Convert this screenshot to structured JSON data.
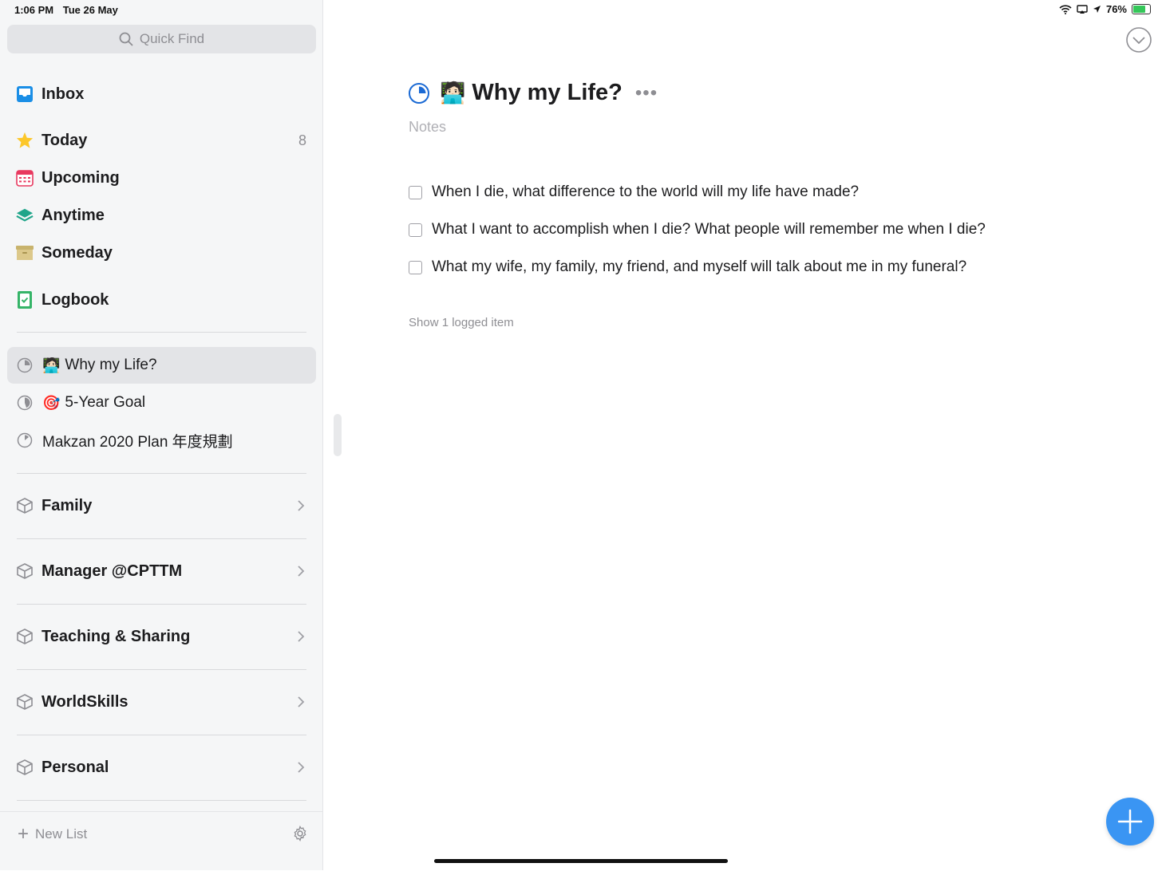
{
  "status_bar": {
    "time": "1:06 PM",
    "date": "Tue 26 May",
    "battery_percent": "76%"
  },
  "search": {
    "placeholder": "Quick Find"
  },
  "nav": {
    "inbox": "Inbox",
    "today": "Today",
    "today_count": "8",
    "upcoming": "Upcoming",
    "anytime": "Anytime",
    "someday": "Someday",
    "logbook": "Logbook"
  },
  "projects": [
    {
      "emoji": "🧑🏻‍💻",
      "label": "Why my Life?"
    },
    {
      "emoji": "🎯",
      "label": "5-Year Goal"
    },
    {
      "emoji": "",
      "label": "Makzan 2020 Plan 年度規劃"
    }
  ],
  "areas": [
    {
      "label": "Family"
    },
    {
      "label": "Manager @CPTTM"
    },
    {
      "label": "Teaching & Sharing"
    },
    {
      "label": "WorldSkills"
    },
    {
      "label": "Personal"
    }
  ],
  "footer": {
    "new_list": "New List"
  },
  "main": {
    "title_emoji": "🧑🏻‍💻",
    "title": "Why my Life?",
    "more": "•••",
    "notes_placeholder": "Notes",
    "todos": [
      "When I die, what difference to the world will my life have made?",
      "What I want to accomplish when I die? What people will remember me when I die?",
      "What my wife, my family, my friend, and myself will talk about me in my funeral?"
    ],
    "logged_link": "Show 1 logged item"
  },
  "colors": {
    "accent": "#1b6ad4",
    "fab": "#3a95f3"
  }
}
